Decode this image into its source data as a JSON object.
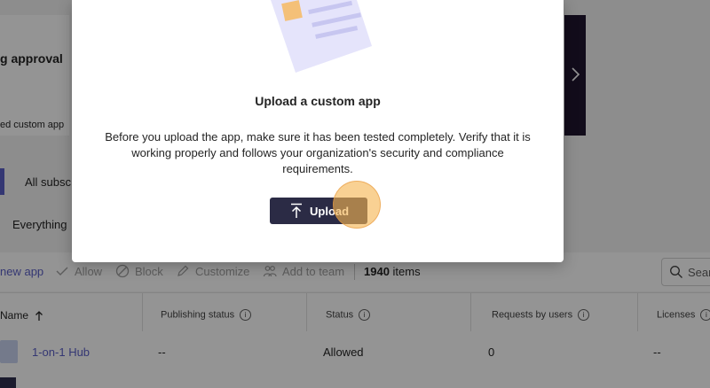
{
  "background": {
    "pending_heading": "g approval",
    "custom_app_snippet": "ed custom app",
    "tab_all_subscriptions": "All subsc",
    "filter_everything": "Everything",
    "toolbar": {
      "new_app": "new app",
      "allow": "Allow",
      "block": "Block",
      "customize": "Customize",
      "add_to_team": "Add to team",
      "item_count": "1940",
      "items_label": "items",
      "search_placeholder": "Sear"
    },
    "table": {
      "columns": [
        "Name",
        "Publishing status",
        "Status",
        "Requests by users",
        "Licenses"
      ],
      "rows": [
        {
          "name": "1-on-1 Hub",
          "publishing_status": "--",
          "status": "Allowed",
          "requests": "0",
          "licenses": "--"
        }
      ]
    }
  },
  "modal": {
    "title": "Upload a custom app",
    "body": "Before you upload the app, make sure it has been tested completely. Verify that it is working properly and follows your organization's security and compliance requirements.",
    "upload_button": "Upload"
  },
  "colors": {
    "accent": "#5b5fc7",
    "upload_button_bg": "#2b2b45",
    "cursor_highlight": "#f5b450"
  },
  "icons": [
    "chevron-right-icon",
    "check-icon",
    "block-icon",
    "pencil-icon",
    "people-icon",
    "search-icon",
    "sort-arrow-up-icon",
    "info-icon",
    "upload-arrow-icon"
  ]
}
